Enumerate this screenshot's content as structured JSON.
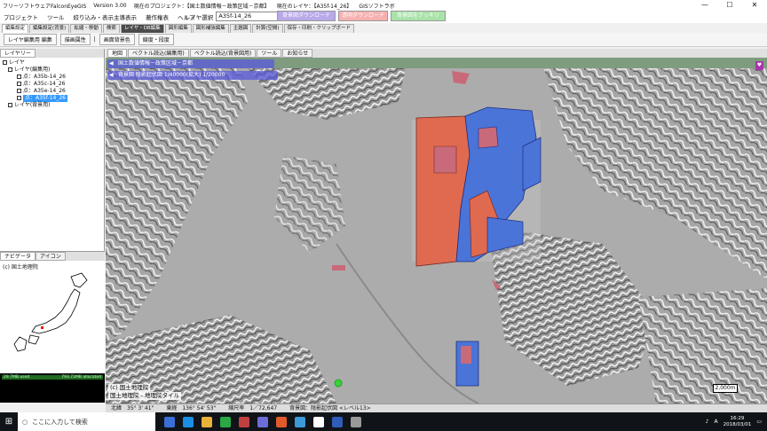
{
  "titlebar": {
    "app": "フリーソフトウェアFalconEyeGIS",
    "version": "Version 3.00",
    "project": "現在のプロジェクト：【国土数値情報－政策区域－京都】",
    "layer": "現在のレイヤ：【A35f-14_26】",
    "vendor": "GISソフトラボ"
  },
  "menu": [
    "プロジェクト",
    "ツール",
    "絞り込み・表示主導表示",
    "著作権表",
    "ヘルプ"
  ],
  "layer_select": {
    "label": "レイヤ選択",
    "value": "A35f-14_26"
  },
  "top_buttons": [
    {
      "label": "背景図ダウンロード",
      "color": "#b9a9e9"
    },
    {
      "label": "透明ダウンロード",
      "color": "#f7b0b0"
    },
    {
      "label": "背景図をクッキリ",
      "color": "#a9e2a9"
    }
  ],
  "tabs": [
    "編集設定",
    "編集設定(背景)",
    "拡縮・移動",
    "検索",
    "レイヤ・DB編集",
    "図形編集",
    "図形補強編集",
    "主題図",
    "計算(空間)",
    "保存・印刷・クリップボード"
  ],
  "toolbar": [
    "レイヤ編集用 編集",
    "描画属性",
    "画面背景色",
    "線度・段度"
  ],
  "left_tabs": [
    "レイヤリー"
  ],
  "tree": [
    {
      "label": "レイヤ",
      "indent": 0
    },
    {
      "label": "レイヤ(編集用)",
      "indent": 1
    },
    {
      "label": "点：A35b-14_26",
      "indent": 2
    },
    {
      "label": "点：A35c-14_26",
      "indent": 2
    },
    {
      "label": "点：A35e-14_26",
      "indent": 2
    },
    {
      "label": "点：A35f-14_26",
      "indent": 2,
      "selected": true
    },
    {
      "label": "レイヤ(背景用)",
      "indent": 1
    }
  ],
  "nav_tabs": [
    "ナビゲータ",
    "アイコン"
  ],
  "nav_copyright": "(c) 国土地理院",
  "status_strip": {
    "left": "29.7MB used",
    "right": "793.72MB allocated"
  },
  "map_tabs": [
    "地図",
    "ベクトル読込(編集用)",
    "ベクトル読込(背景図用)",
    "ツール",
    "お知らせ"
  ],
  "overlays": [
    "国土数値情報－政策区域－京都",
    "背景図 陰影起伏図 1/40000(拡大) 1/20000"
  ],
  "map_copyright": [
    "(c) 国土地理院",
    "国土地理院 - 地理院タイル"
  ],
  "scale": "2,000m",
  "statusbar": {
    "lat": "北緯　35° 3' 41\"",
    "lon": "東経　136° 54' 53\"",
    "ratio": "縮尺率　1／72,647",
    "bg": "背景図：陰影起伏図 <レベル13>"
  },
  "taskbar": {
    "search_placeholder": "ここに入力して検索",
    "time": "16:29",
    "date": "2018/03/01",
    "ime": "A"
  }
}
